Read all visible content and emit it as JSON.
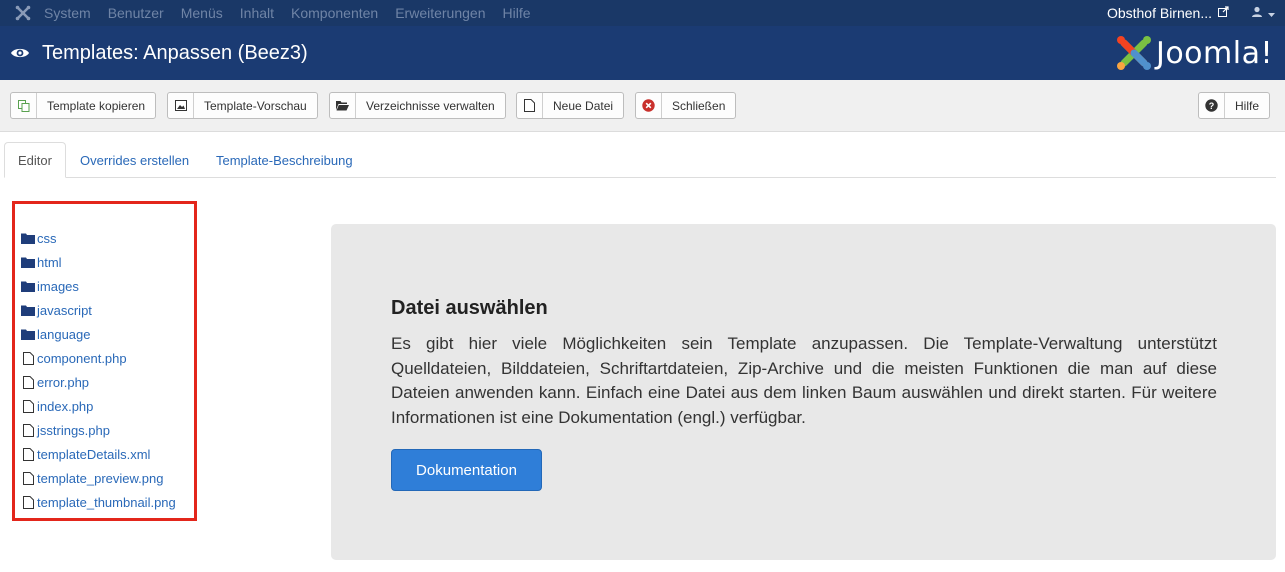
{
  "topbar": {
    "menu": [
      "System",
      "Benutzer",
      "Menüs",
      "Inhalt",
      "Komponenten",
      "Erweiterungen",
      "Hilfe"
    ],
    "site_name": "Obsthof Birnen...",
    "site_icon": "external-link-icon",
    "user_icon": "user-icon"
  },
  "header": {
    "title": "Templates: Anpassen (Beez3)",
    "brand": "Joomla!"
  },
  "toolbar": {
    "copy_label": "Template kopieren",
    "preview_label": "Template-Vorschau",
    "folders_label": "Verzeichnisse verwalten",
    "newfile_label": "Neue Datei",
    "close_label": "Schließen",
    "help_label": "Hilfe"
  },
  "tabs": {
    "editor": "Editor",
    "overrides": "Overrides erstellen",
    "description": "Template-Beschreibung"
  },
  "tree": {
    "items": [
      {
        "label": "css",
        "type": "folder"
      },
      {
        "label": "html",
        "type": "folder"
      },
      {
        "label": "images",
        "type": "folder"
      },
      {
        "label": "javascript",
        "type": "folder"
      },
      {
        "label": "language",
        "type": "folder"
      },
      {
        "label": "component.php",
        "type": "file"
      },
      {
        "label": "error.php",
        "type": "file"
      },
      {
        "label": "index.php",
        "type": "file"
      },
      {
        "label": "jsstrings.php",
        "type": "file"
      },
      {
        "label": "templateDetails.xml",
        "type": "file"
      },
      {
        "label": "template_preview.png",
        "type": "file"
      },
      {
        "label": "template_thumbnail.png",
        "type": "file"
      }
    ]
  },
  "panel": {
    "heading": "Datei auswählen",
    "text": "Es gibt hier viele Möglichkeiten sein Template anzupassen. Die Template-Verwaltung unterstützt Quelldateien, Bilddateien, Schriftartdateien, Zip-Archive und die meisten Funktionen die man auf diese Dateien anwenden kann. Einfach eine Datei aus dem linken Baum auswählen und direkt starten. Für weitere Informationen ist eine Dokumentation (engl.) verfügbar.",
    "button_label": "Dokumentation"
  },
  "colors": {
    "topbar": "#1a3867",
    "header": "#1b3b73",
    "link": "#2a69b8",
    "highlight_border": "#e3261b",
    "primary_button": "#2f7ed8"
  }
}
